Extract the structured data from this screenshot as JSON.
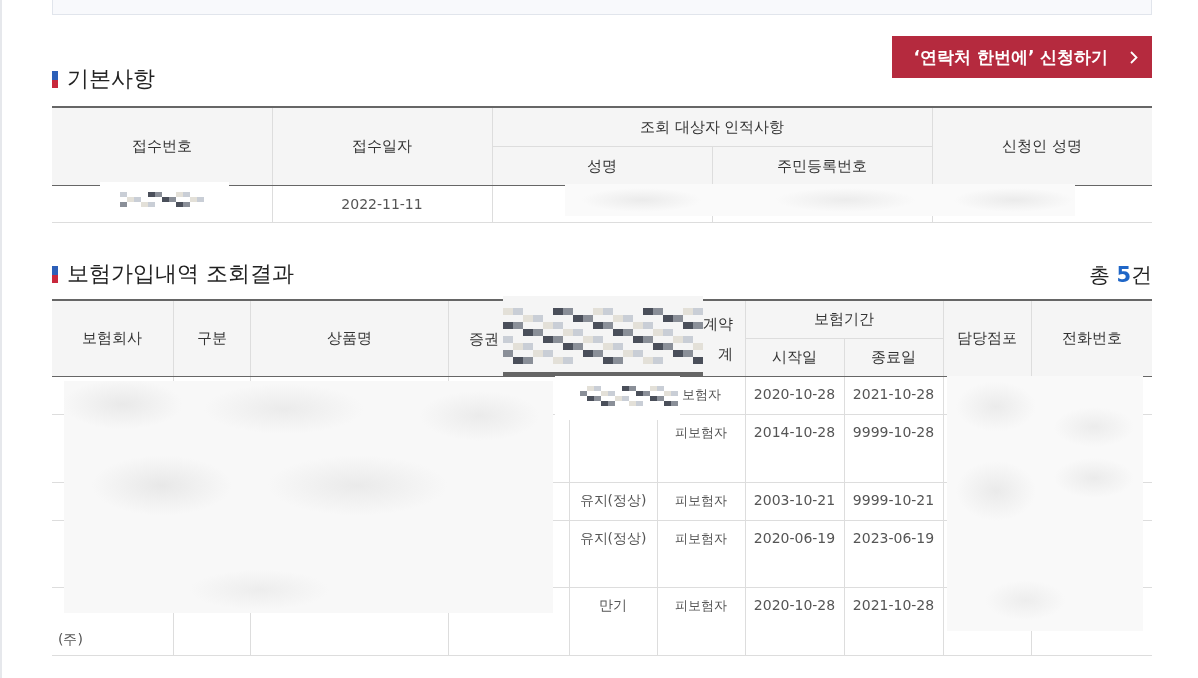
{
  "apply_button": {
    "label": "‘연락처 한번에’ 신청하기"
  },
  "basic": {
    "title": "기본사항",
    "columns": [
      {
        "label": "접수번호"
      },
      {
        "label": "접수일자"
      },
      {
        "label": "조회 대상자 인적사항",
        "children": [
          "성명",
          "주민등록번호"
        ]
      },
      {
        "label": "신청인 성명"
      }
    ],
    "row": {
      "receipt_date": "2022-11-11"
    }
  },
  "results": {
    "title": "보험가입내역 조회결과",
    "total": {
      "prefix": "총",
      "count": "5",
      "suffix": "건"
    },
    "columns": [
      {
        "lines": [
          "보험회사"
        ]
      },
      {
        "lines": [
          "구분"
        ]
      },
      {
        "lines": [
          "상품명"
        ]
      },
      {
        "lines": [
          "증권"
        ]
      },
      {},
      {
        "lines": [
          "계약",
          "계"
        ]
      },
      {
        "label": "보험기간",
        "children": [
          "시작일",
          "종료일"
        ]
      },
      {
        "lines": [
          "담당점포"
        ]
      },
      {
        "lines": [
          "전화번호"
        ]
      }
    ],
    "rows": [
      {
        "role": "보험자",
        "start": "2020-10-28",
        "end": "2021-10-28"
      },
      {
        "role": "피보험자",
        "start": "2014-10-28",
        "end": "9999-10-28"
      },
      {
        "status": "유지(정상)",
        "role": "피보험자",
        "start": "2003-10-21",
        "end": "9999-10-21"
      },
      {
        "status": "유지(정상)",
        "role": "피보험자",
        "start": "2020-06-19",
        "end": "2023-06-19"
      },
      {
        "company": [
          "(주)"
        ],
        "status": "만기",
        "role": "피보험자",
        "start": "2020-10-28",
        "end": "2021-10-28"
      }
    ]
  }
}
